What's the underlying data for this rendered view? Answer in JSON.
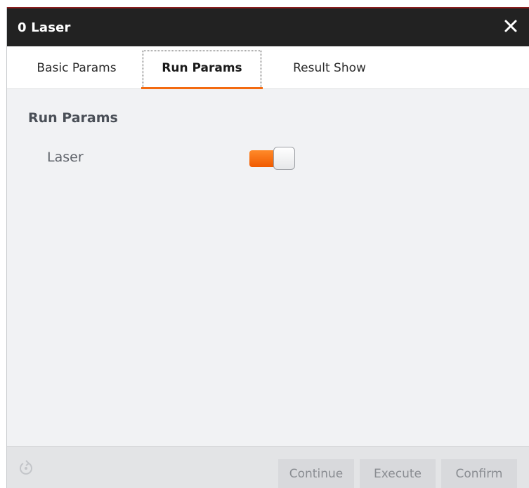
{
  "window": {
    "title": "0 Laser",
    "close_icon": "close-icon"
  },
  "tabs": [
    {
      "label": "Basic Params",
      "active": false
    },
    {
      "label": "Run Params",
      "active": true
    },
    {
      "label": "Result Show",
      "active": false
    }
  ],
  "panel": {
    "section_title": "Run Params",
    "fields": [
      {
        "label": "Laser",
        "type": "toggle",
        "value": true
      }
    ]
  },
  "footer": {
    "refresh_icon": "refresh-icon",
    "buttons": {
      "continue": "Continue",
      "execute": "Execute",
      "confirm": "Confirm"
    }
  },
  "colors": {
    "titlebar": "#222222",
    "accent": "#f36a10",
    "background": "#f1f2f4"
  }
}
